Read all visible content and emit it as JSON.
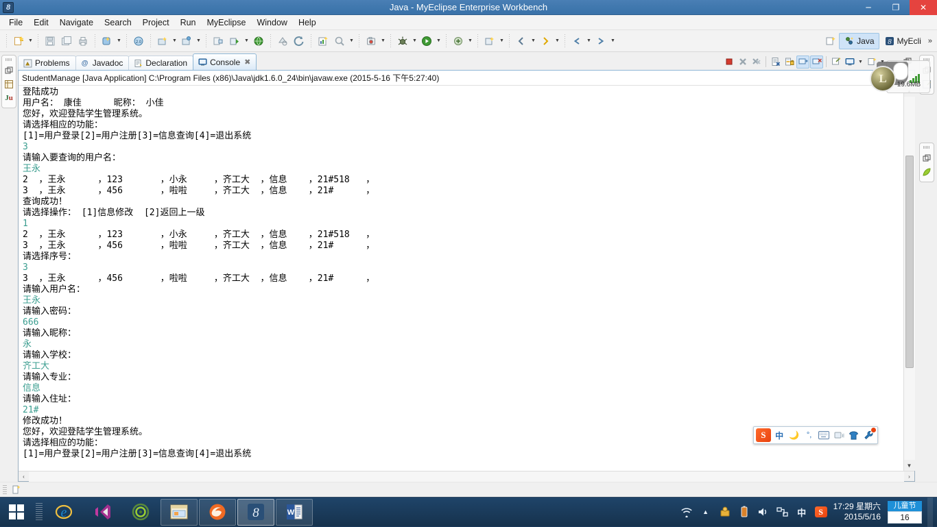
{
  "window": {
    "title": "Java - MyEclipse Enterprise Workbench",
    "icon": "myeclipse-icon",
    "minimize_label": "─",
    "maximize_label": "❐",
    "close_label": "✕"
  },
  "menubar": {
    "items": [
      {
        "label": "File"
      },
      {
        "label": "Edit"
      },
      {
        "label": "Navigate"
      },
      {
        "label": "Search"
      },
      {
        "label": "Project"
      },
      {
        "label": "Run"
      },
      {
        "label": "MyEclipse"
      },
      {
        "label": "Window"
      },
      {
        "label": "Help"
      }
    ]
  },
  "toolbar": {
    "perspective_new_label": "",
    "perspectives": [
      {
        "label": "Java",
        "active": true
      },
      {
        "label": "MyEcli",
        "active": false
      }
    ],
    "overflow_label": "»"
  },
  "views": {
    "tabs": [
      {
        "label": "Problems",
        "icon": "problems-icon",
        "active": false
      },
      {
        "label": "Javadoc",
        "icon": "javadoc-icon",
        "active": false
      },
      {
        "label": "Declaration",
        "icon": "declaration-icon",
        "active": false
      },
      {
        "label": "Console",
        "icon": "console-icon",
        "active": true,
        "close": "✖"
      }
    ]
  },
  "console": {
    "header": "StudentManage [Java Application] C:\\Program Files (x86)\\Java\\jdk1.6.0_24\\bin\\javaw.exe (2015-5-16 下午5:27:40)",
    "lines": [
      {
        "text": "登陆成功",
        "kind": "out"
      },
      {
        "text": "用户名： 康佳      昵称： 小佳",
        "kind": "out"
      },
      {
        "text": "您好，欢迎登陆学生管理系统。",
        "kind": "out"
      },
      {
        "text": "请选择相应的功能：",
        "kind": "out"
      },
      {
        "text": "[1]=用户登录[2]=用户注册[3]=信息查询[4]=退出系统",
        "kind": "out"
      },
      {
        "text": "3",
        "kind": "in"
      },
      {
        "text": "请输入要查询的用户名：",
        "kind": "out"
      },
      {
        "text": "王永",
        "kind": "in"
      },
      {
        "text": "2  ，王永      ，123       ，小永     ，齐工大  ，信息    ，21#518   ，",
        "kind": "out"
      },
      {
        "text": "3  ，王永      ，456       ，啦啦     ，齐工大  ，信息    ，21#      ，",
        "kind": "out"
      },
      {
        "text": "查询成功！",
        "kind": "out"
      },
      {
        "text": "请选择操作： [1]信息修改  [2]返回上一级",
        "kind": "out"
      },
      {
        "text": "1",
        "kind": "in"
      },
      {
        "text": "2  ，王永      ，123       ，小永     ，齐工大  ，信息    ，21#518   ，",
        "kind": "out"
      },
      {
        "text": "3  ，王永      ，456       ，啦啦     ，齐工大  ，信息    ，21#      ，",
        "kind": "out"
      },
      {
        "text": "请选择序号：",
        "kind": "out"
      },
      {
        "text": "3",
        "kind": "in"
      },
      {
        "text": "3  ，王永      ，456       ，啦啦     ，齐工大  ，信息    ，21#      ，",
        "kind": "out"
      },
      {
        "text": "请输入用户名：",
        "kind": "out"
      },
      {
        "text": "王永",
        "kind": "in"
      },
      {
        "text": "请输入密码：",
        "kind": "out"
      },
      {
        "text": "666",
        "kind": "in"
      },
      {
        "text": "请输入昵称：",
        "kind": "out"
      },
      {
        "text": "永",
        "kind": "in"
      },
      {
        "text": "请输入学校：",
        "kind": "out"
      },
      {
        "text": "齐工大",
        "kind": "in"
      },
      {
        "text": "请输入专业：",
        "kind": "out"
      },
      {
        "text": "信息",
        "kind": "in"
      },
      {
        "text": "请输入住址：",
        "kind": "out"
      },
      {
        "text": "21#",
        "kind": "in"
      },
      {
        "text": "修改成功！",
        "kind": "out"
      },
      {
        "text": "您好，欢迎登陆学生管理系统。",
        "kind": "out"
      },
      {
        "text": "请选择相应的功能：",
        "kind": "out"
      },
      {
        "text": "[1]=用户登录[2]=用户注册[3]=信息查询[4]=退出系统",
        "kind": "out"
      }
    ],
    "scroll_up_label": "▲",
    "scroll_down_label": "▼",
    "scroll_left_label": "‹",
    "scroll_right_label": "›",
    "toolbar_buttons": [
      {
        "name": "terminate-button",
        "icon": "stop-square-icon"
      },
      {
        "name": "remove-launch-button",
        "icon": "remove-x-icon"
      },
      {
        "name": "remove-all-terminated-button",
        "icon": "remove-all-x-icon"
      },
      {
        "name": "clear-console-button",
        "icon": "clear-console-icon"
      },
      {
        "name": "scroll-lock-button",
        "icon": "scroll-lock-icon"
      },
      {
        "name": "show-console-on-output-button",
        "icon": "show-console-output-icon"
      },
      {
        "name": "show-console-on-error-button",
        "icon": "show-console-error-icon"
      },
      {
        "name": "pin-console-button",
        "icon": "pin-icon"
      },
      {
        "name": "display-selected-console-button",
        "icon": "display-console-icon"
      },
      {
        "name": "open-console-button",
        "icon": "new-console-icon"
      },
      {
        "name": "minimize-view-button",
        "icon": "minimize-icon"
      },
      {
        "name": "maximize-view-button",
        "icon": "maximize-icon"
      }
    ]
  },
  "fastview": {
    "left_icons": [
      "restore-icon",
      "package-explorer-icon",
      "junit-icon"
    ],
    "left_junit_label": "Ju",
    "right_icons": [
      "restore-icon",
      "outline-icon",
      "restore-icon",
      "leaf-icon"
    ]
  },
  "memory_monitor": {
    "value": "19.6MB",
    "badge_label": "L"
  },
  "ime": {
    "logo_label": "S",
    "mode_label": "中",
    "icons": [
      "moon-icon",
      "punctuation-icon",
      "keyboard-icon",
      "voice-input-icon",
      "skin-icon",
      "toolbox-icon"
    ]
  },
  "taskbar": {
    "start_label": "start-button",
    "items": [
      {
        "name": "internet-explorer",
        "icon": "ie-icon",
        "state": "pinned"
      },
      {
        "name": "visual-studio",
        "icon": "vs-icon",
        "state": "pinned"
      },
      {
        "name": "media-player",
        "icon": "circle-icon",
        "state": "pinned"
      },
      {
        "name": "file-explorer",
        "icon": "folder-icon",
        "state": "running"
      },
      {
        "name": "firefox",
        "icon": "firefox-icon",
        "state": "running"
      },
      {
        "name": "myeclipse",
        "icon": "myeclipse-icon",
        "state": "active"
      },
      {
        "name": "word",
        "icon": "word-icon",
        "state": "running"
      }
    ],
    "tray": {
      "icons": [
        "show-hidden-icon",
        "wifi-icon",
        "security-icon",
        "battery-icon",
        "volume-icon",
        "network-icon"
      ],
      "language_label": "中",
      "sogou_label": "S"
    },
    "clock": {
      "time": "17:29 星期六",
      "date": "2015/5/16"
    },
    "calendar": {
      "festival": "儿童节",
      "day": "16"
    }
  },
  "colors": {
    "title_bar": "#4078ae",
    "close_button": "#e5433f",
    "console_input_text": "#3a9d8f",
    "console_output_text": "#000000",
    "accent": "#cfe3f7",
    "taskbar": "#1f4469"
  }
}
